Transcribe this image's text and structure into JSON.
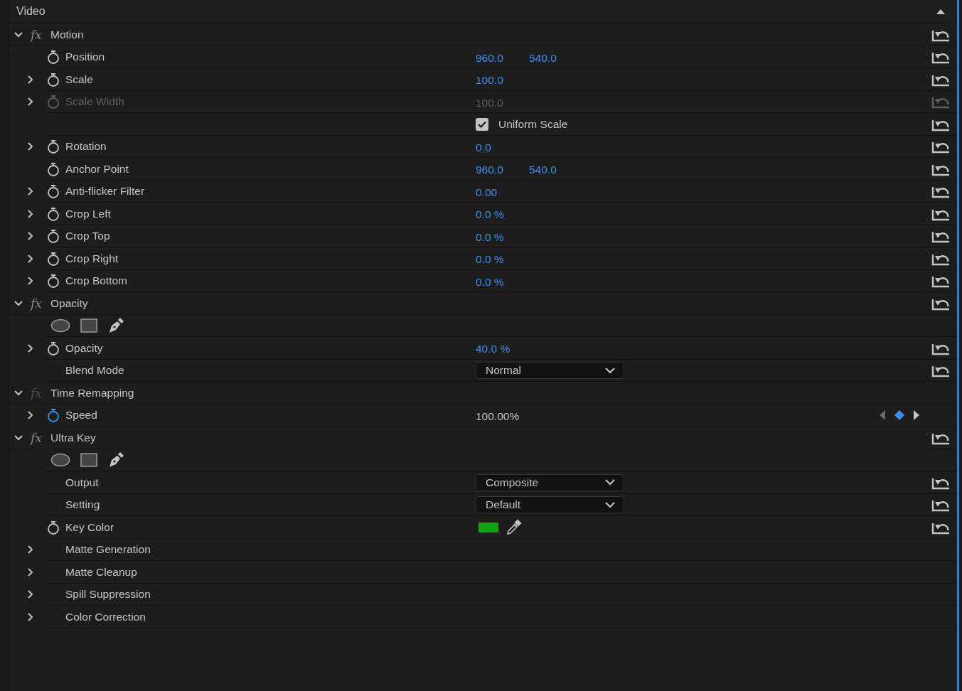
{
  "section": {
    "title": "Video"
  },
  "rows": [
    {
      "kind": "effect",
      "fx": "fx",
      "label": "Motion",
      "expanded": true,
      "fx_enabled": true,
      "reset": true
    },
    {
      "kind": "param",
      "label": "Position",
      "animated": false,
      "disabled": false,
      "values": [
        "960.0",
        "540.0"
      ],
      "editable": true,
      "reset": true
    },
    {
      "kind": "param",
      "label": "Scale",
      "expanded": false,
      "animated": false,
      "disabled": false,
      "values": [
        "100.0"
      ],
      "editable": true,
      "reset": true
    },
    {
      "kind": "param",
      "label": "Scale Width",
      "expanded": false,
      "animated": false,
      "disabled": true,
      "values": [
        "100.0"
      ],
      "editable": true,
      "reset": true
    },
    {
      "kind": "checkbox",
      "label": "Uniform Scale",
      "checked": true,
      "reset": true
    },
    {
      "kind": "param",
      "label": "Rotation",
      "expanded": false,
      "animated": false,
      "disabled": false,
      "values": [
        "0.0"
      ],
      "editable": true,
      "reset": true
    },
    {
      "kind": "param",
      "label": "Anchor Point",
      "animated": false,
      "disabled": false,
      "values": [
        "960.0",
        "540.0"
      ],
      "editable": true,
      "reset": true
    },
    {
      "kind": "param",
      "label": "Anti-flicker Filter",
      "expanded": false,
      "animated": false,
      "disabled": false,
      "values": [
        "0.00"
      ],
      "editable": true,
      "reset": true
    },
    {
      "kind": "param",
      "label": "Crop Left",
      "expanded": false,
      "animated": false,
      "disabled": false,
      "values": [
        "0.0 %"
      ],
      "editable": true,
      "reset": true
    },
    {
      "kind": "param",
      "label": "Crop Top",
      "expanded": false,
      "animated": false,
      "disabled": false,
      "values": [
        "0.0 %"
      ],
      "editable": true,
      "reset": true
    },
    {
      "kind": "param",
      "label": "Crop Right",
      "expanded": false,
      "animated": false,
      "disabled": false,
      "values": [
        "0.0 %"
      ],
      "editable": true,
      "reset": true
    },
    {
      "kind": "param",
      "label": "Crop Bottom",
      "expanded": false,
      "animated": false,
      "disabled": false,
      "values": [
        "0.0 %"
      ],
      "editable": true,
      "reset": true
    },
    {
      "kind": "effect",
      "fx": "fx",
      "label": "Opacity",
      "expanded": true,
      "fx_enabled": true,
      "reset": true
    },
    {
      "kind": "masks",
      "reset": false
    },
    {
      "kind": "param",
      "label": "Opacity",
      "expanded": false,
      "animated": false,
      "disabled": false,
      "values": [
        "40.0 %"
      ],
      "editable": true,
      "reset": true
    },
    {
      "kind": "dropdown",
      "label": "Blend Mode",
      "value": "Normal",
      "reset": true
    },
    {
      "kind": "effect",
      "fx": "fx",
      "label": "Time Remapping",
      "expanded": true,
      "fx_enabled": false,
      "reset": false
    },
    {
      "kind": "param",
      "label": "Speed",
      "expanded": false,
      "animated": true,
      "disabled": false,
      "values": [
        "100.00%"
      ],
      "editable": false,
      "keyframe_nav": true,
      "reset": false
    },
    {
      "kind": "effect",
      "fx": "fx",
      "label": "Ultra Key",
      "expanded": true,
      "fx_enabled": true,
      "reset": true
    },
    {
      "kind": "masks",
      "reset": false
    },
    {
      "kind": "dropdown",
      "label": "Output",
      "value": "Composite",
      "reset": true
    },
    {
      "kind": "dropdown",
      "label": "Setting",
      "value": "Default",
      "reset": true
    },
    {
      "kind": "color",
      "label": "Key Color",
      "animated": false,
      "color": "#13a013",
      "reset": true
    },
    {
      "kind": "group",
      "label": "Matte Generation",
      "expanded": false
    },
    {
      "kind": "group",
      "label": "Matte Cleanup",
      "expanded": false
    },
    {
      "kind": "group",
      "label": "Spill Suppression",
      "expanded": false
    },
    {
      "kind": "group",
      "label": "Color Correction",
      "expanded": false
    }
  ]
}
